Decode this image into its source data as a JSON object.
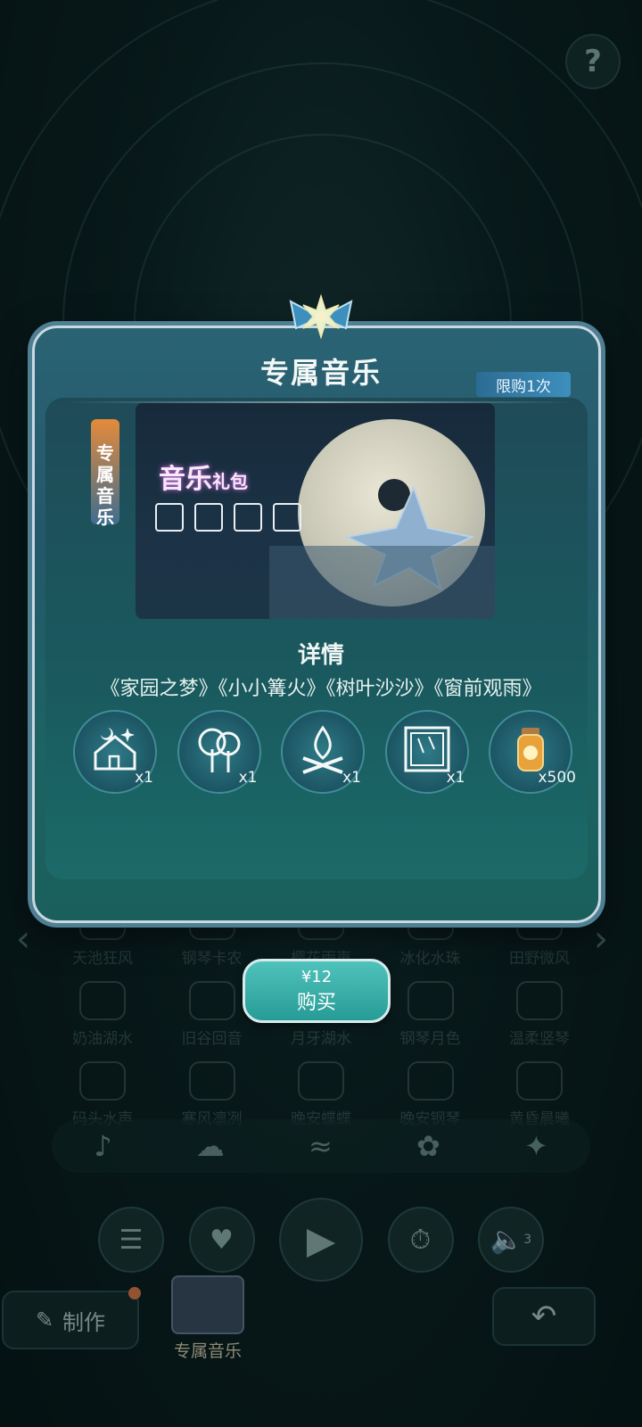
{
  "help": {
    "label": "?"
  },
  "modal": {
    "title": "专属音乐",
    "limit_badge": "限购1次",
    "side_tag": "专属音乐",
    "pack_title": "音乐",
    "pack_title_small": "礼包",
    "details_heading": "详情",
    "tracks": "《家园之梦》《小小篝火》《树叶沙沙》《窗前观雨》",
    "rewards": [
      {
        "name": "家园之梦",
        "icon": "house-moon-icon",
        "qty": "x1"
      },
      {
        "name": "树叶沙沙",
        "icon": "tree-icon",
        "qty": "x1"
      },
      {
        "name": "小小篝火",
        "icon": "campfire-icon",
        "qty": "x1"
      },
      {
        "name": "窗前观雨",
        "icon": "window-rain-icon",
        "qty": "x1"
      },
      {
        "name": "萤火罐",
        "icon": "firefly-jar-icon",
        "qty": "x500"
      }
    ]
  },
  "buy": {
    "price": "¥12",
    "label": "购买"
  },
  "background_sounds": [
    [
      "天池狂风",
      "钢琴卡农",
      "樱花雨声",
      "冰化水珠",
      "田野微风"
    ],
    [
      "奶油湖水",
      "旧谷回音",
      "月牙湖水",
      "钢琴月色",
      "温柔竖琴"
    ],
    [
      "码头水声",
      "寒风凛冽",
      "晚安蝶蝶",
      "晚安钢琴",
      "黄昏晨曦"
    ]
  ],
  "bottom": {
    "make_label": "制作",
    "exclusive_label": "专属音乐",
    "volume_badge": "3"
  },
  "colors": {
    "accent": "#279b95",
    "modal": "#23586a",
    "badge": "#3d8fbd"
  }
}
